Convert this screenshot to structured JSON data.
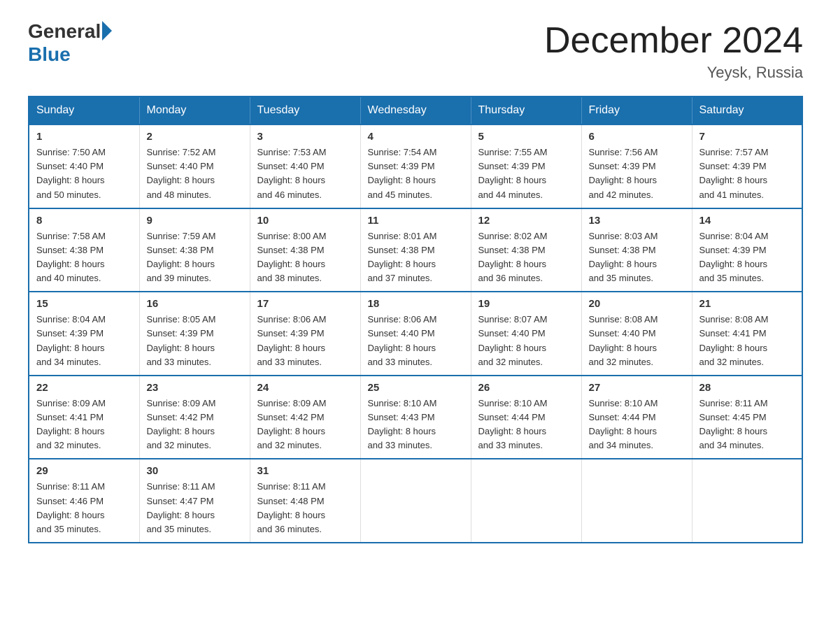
{
  "logo": {
    "general": "General",
    "blue": "Blue"
  },
  "header": {
    "title": "December 2024",
    "location": "Yeysk, Russia"
  },
  "days_of_week": [
    "Sunday",
    "Monday",
    "Tuesday",
    "Wednesday",
    "Thursday",
    "Friday",
    "Saturday"
  ],
  "weeks": [
    [
      {
        "day": "1",
        "sunrise": "7:50 AM",
        "sunset": "4:40 PM",
        "daylight": "8 hours and 50 minutes."
      },
      {
        "day": "2",
        "sunrise": "7:52 AM",
        "sunset": "4:40 PM",
        "daylight": "8 hours and 48 minutes."
      },
      {
        "day": "3",
        "sunrise": "7:53 AM",
        "sunset": "4:40 PM",
        "daylight": "8 hours and 46 minutes."
      },
      {
        "day": "4",
        "sunrise": "7:54 AM",
        "sunset": "4:39 PM",
        "daylight": "8 hours and 45 minutes."
      },
      {
        "day": "5",
        "sunrise": "7:55 AM",
        "sunset": "4:39 PM",
        "daylight": "8 hours and 44 minutes."
      },
      {
        "day": "6",
        "sunrise": "7:56 AM",
        "sunset": "4:39 PM",
        "daylight": "8 hours and 42 minutes."
      },
      {
        "day": "7",
        "sunrise": "7:57 AM",
        "sunset": "4:39 PM",
        "daylight": "8 hours and 41 minutes."
      }
    ],
    [
      {
        "day": "8",
        "sunrise": "7:58 AM",
        "sunset": "4:38 PM",
        "daylight": "8 hours and 40 minutes."
      },
      {
        "day": "9",
        "sunrise": "7:59 AM",
        "sunset": "4:38 PM",
        "daylight": "8 hours and 39 minutes."
      },
      {
        "day": "10",
        "sunrise": "8:00 AM",
        "sunset": "4:38 PM",
        "daylight": "8 hours and 38 minutes."
      },
      {
        "day": "11",
        "sunrise": "8:01 AM",
        "sunset": "4:38 PM",
        "daylight": "8 hours and 37 minutes."
      },
      {
        "day": "12",
        "sunrise": "8:02 AM",
        "sunset": "4:38 PM",
        "daylight": "8 hours and 36 minutes."
      },
      {
        "day": "13",
        "sunrise": "8:03 AM",
        "sunset": "4:38 PM",
        "daylight": "8 hours and 35 minutes."
      },
      {
        "day": "14",
        "sunrise": "8:04 AM",
        "sunset": "4:39 PM",
        "daylight": "8 hours and 35 minutes."
      }
    ],
    [
      {
        "day": "15",
        "sunrise": "8:04 AM",
        "sunset": "4:39 PM",
        "daylight": "8 hours and 34 minutes."
      },
      {
        "day": "16",
        "sunrise": "8:05 AM",
        "sunset": "4:39 PM",
        "daylight": "8 hours and 33 minutes."
      },
      {
        "day": "17",
        "sunrise": "8:06 AM",
        "sunset": "4:39 PM",
        "daylight": "8 hours and 33 minutes."
      },
      {
        "day": "18",
        "sunrise": "8:06 AM",
        "sunset": "4:40 PM",
        "daylight": "8 hours and 33 minutes."
      },
      {
        "day": "19",
        "sunrise": "8:07 AM",
        "sunset": "4:40 PM",
        "daylight": "8 hours and 32 minutes."
      },
      {
        "day": "20",
        "sunrise": "8:08 AM",
        "sunset": "4:40 PM",
        "daylight": "8 hours and 32 minutes."
      },
      {
        "day": "21",
        "sunrise": "8:08 AM",
        "sunset": "4:41 PM",
        "daylight": "8 hours and 32 minutes."
      }
    ],
    [
      {
        "day": "22",
        "sunrise": "8:09 AM",
        "sunset": "4:41 PM",
        "daylight": "8 hours and 32 minutes."
      },
      {
        "day": "23",
        "sunrise": "8:09 AM",
        "sunset": "4:42 PM",
        "daylight": "8 hours and 32 minutes."
      },
      {
        "day": "24",
        "sunrise": "8:09 AM",
        "sunset": "4:42 PM",
        "daylight": "8 hours and 32 minutes."
      },
      {
        "day": "25",
        "sunrise": "8:10 AM",
        "sunset": "4:43 PM",
        "daylight": "8 hours and 33 minutes."
      },
      {
        "day": "26",
        "sunrise": "8:10 AM",
        "sunset": "4:44 PM",
        "daylight": "8 hours and 33 minutes."
      },
      {
        "day": "27",
        "sunrise": "8:10 AM",
        "sunset": "4:44 PM",
        "daylight": "8 hours and 34 minutes."
      },
      {
        "day": "28",
        "sunrise": "8:11 AM",
        "sunset": "4:45 PM",
        "daylight": "8 hours and 34 minutes."
      }
    ],
    [
      {
        "day": "29",
        "sunrise": "8:11 AM",
        "sunset": "4:46 PM",
        "daylight": "8 hours and 35 minutes."
      },
      {
        "day": "30",
        "sunrise": "8:11 AM",
        "sunset": "4:47 PM",
        "daylight": "8 hours and 35 minutes."
      },
      {
        "day": "31",
        "sunrise": "8:11 AM",
        "sunset": "4:48 PM",
        "daylight": "8 hours and 36 minutes."
      },
      null,
      null,
      null,
      null
    ]
  ],
  "labels": {
    "sunrise": "Sunrise:",
    "sunset": "Sunset:",
    "daylight": "Daylight:"
  }
}
